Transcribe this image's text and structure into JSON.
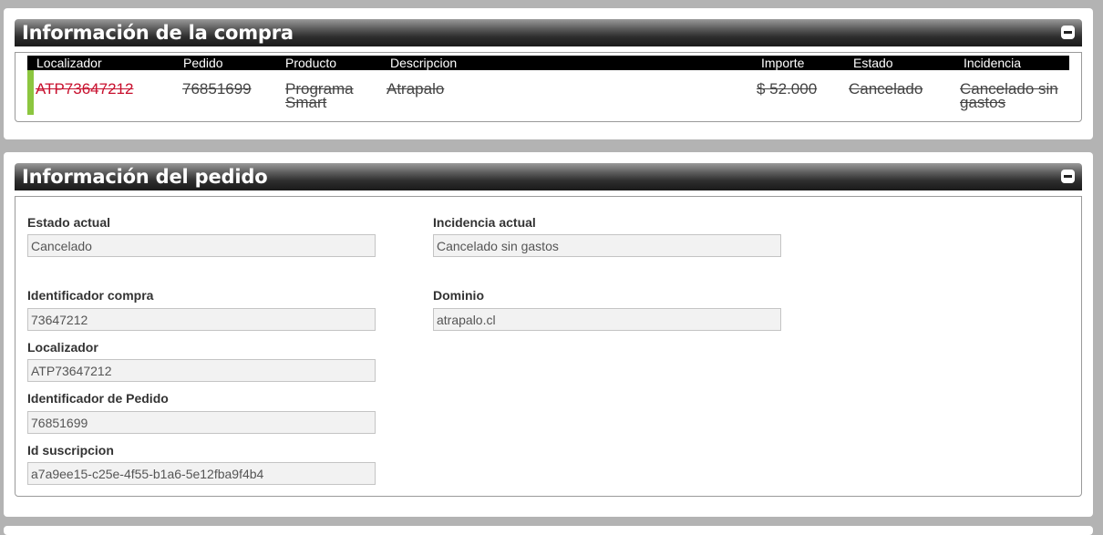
{
  "purchase": {
    "title": "Información de la compra",
    "headers": {
      "localizador": "Localizador",
      "pedido": "Pedido",
      "producto": "Producto",
      "descripcion": "Descripcion",
      "importe": "Importe",
      "estado": "Estado",
      "incidencia": "Incidencia"
    },
    "row": {
      "localizador": "ATP73647212",
      "pedido": "76851699",
      "producto_l1": "Programa",
      "producto_l2": "Smart",
      "descripcion": "Atrapalo",
      "importe": "$ 52.000",
      "estado": "Cancelado",
      "incidencia_l1": "Cancelado sin",
      "incidencia_l2": "gastos"
    }
  },
  "order": {
    "title": "Información del pedido",
    "estado_actual_label": "Estado actual",
    "estado_actual_value": "Cancelado",
    "incidencia_actual_label": "Incidencia actual",
    "incidencia_actual_value": "Cancelado sin gastos",
    "identificador_compra_label": "Identificador compra",
    "identificador_compra_value": "73647212",
    "dominio_label": "Dominio",
    "dominio_value": "atrapalo.cl",
    "localizador_label": "Localizador",
    "localizador_value": "ATP73647212",
    "identificador_pedido_label": "Identificador de Pedido",
    "identificador_pedido_value": "76851699",
    "id_suscripcion_label": "Id suscripcion",
    "id_suscripcion_value": "a7a9ee15-c25e-4f55-b1a6-5e12fba9f4b4"
  },
  "colors": {
    "background": "#b3b3b3",
    "row_marker": "#8cc63f",
    "localizador_link": "#c8102e"
  },
  "icons": {
    "collapse": "minus-square-icon"
  }
}
